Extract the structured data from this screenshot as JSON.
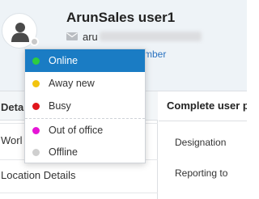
{
  "profile": {
    "name": "ArunSales user1",
    "email_prefix": "aru",
    "member_link": "mber",
    "status_color": "#c9c9c9",
    "icons": {
      "avatar": "user-silhouette-icon",
      "email": "mail-icon"
    }
  },
  "status_menu": {
    "items": [
      {
        "label": "Online",
        "color": "#2ecc40",
        "selected": true
      },
      {
        "label": "Away new",
        "color": "#f2c40f",
        "selected": false
      },
      {
        "label": "Busy",
        "color": "#e0161b",
        "selected": false
      },
      {
        "label": "Out of office",
        "color": "#e615d6",
        "selected": false
      },
      {
        "label": "Offline",
        "color": "#cfcfcf",
        "selected": false
      }
    ],
    "selected_bg": "#1a7cc4"
  },
  "left_nav": {
    "header": "Deta",
    "items": [
      "Worl",
      "Location Details"
    ]
  },
  "main": {
    "title": "Complete user p",
    "fields": [
      "Designation",
      "Reporting to"
    ]
  }
}
